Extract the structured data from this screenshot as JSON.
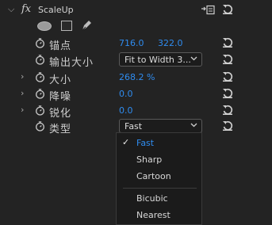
{
  "effect": {
    "name": "ScaleUp",
    "fx_symbol": "fx"
  },
  "properties": [
    {
      "label": "锚点",
      "values": [
        "716.0",
        "322.0"
      ]
    },
    {
      "label": "输出大小",
      "select": "Fit to Width 3..."
    },
    {
      "label": "大小",
      "values": [
        "268.2 %"
      ]
    },
    {
      "label": "降噪",
      "values": [
        "0.0"
      ]
    },
    {
      "label": "锐化",
      "values": [
        "0.0"
      ]
    },
    {
      "label": "类型",
      "select": "Fast"
    }
  ],
  "dropdown": {
    "options": [
      "Fast",
      "Sharp",
      "Cartoon",
      "Bicubic",
      "Nearest"
    ],
    "selected": "Fast",
    "check": "✓"
  },
  "icons": {
    "twisty": "chevron-down-icon",
    "collapsed": "chevron-right-icon",
    "stopwatch": "stopwatch-icon",
    "reset": "reset-icon"
  },
  "colors": {
    "accent": "#2f8cf0",
    "background": "#232323"
  }
}
